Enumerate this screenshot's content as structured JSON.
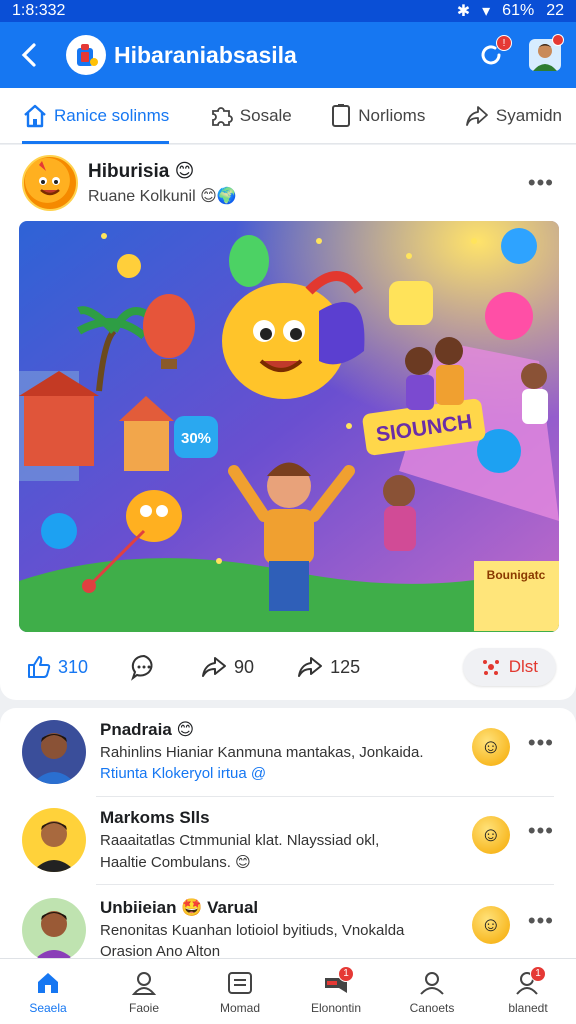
{
  "status_bar": {
    "time": "1:8:332",
    "battery": "61%",
    "clock_right": "22"
  },
  "app": {
    "title": "Hibaraniabsasila"
  },
  "header": {
    "notification_badge": "!",
    "avatar_badge": ""
  },
  "tabs": [
    {
      "label": "Ranice solinms",
      "icon": "home-icon"
    },
    {
      "label": "Sosale",
      "icon": "puzzle-icon"
    },
    {
      "label": "Norlioms",
      "icon": "page-icon"
    },
    {
      "label": "Syamidn",
      "icon": "share-icon"
    }
  ],
  "post": {
    "author": "Hiburisia 😊",
    "subtitle": "Ruane Kolkunil 😊🌍",
    "image": {
      "sign_text": "SIOUNCH",
      "bubble_text": "30%",
      "corner_sign": "Bounigatc"
    },
    "actions": {
      "likes": "310",
      "shares": "90",
      "reposts": "125",
      "main_label": "Dlst"
    }
  },
  "feed": [
    {
      "name": "Pnadraia 😊",
      "line1": "Rahinlins Hianiar Kanmuna mantakas, Jonkaida.",
      "line2": "Rtiunta Klokeryol irtua  @",
      "line2_link": true
    },
    {
      "name": "Markoms Slls",
      "line1": "Raaaitatlas Ctmmunial klat. Nlayssiad okl,",
      "line2": "Haaltie Combulans. 😊",
      "line2_link": false
    },
    {
      "name": "Unbiieian 🤩 Varual",
      "line1": "Renonitas Kuanhan lotioiol byitiuds,  Vnokalda",
      "line2": "Orasion Ano Alton",
      "line2_link": false
    }
  ],
  "bottom_nav": [
    {
      "label": "Seaela",
      "icon": "home-icon",
      "active": true,
      "badge": ""
    },
    {
      "label": "Faoie",
      "icon": "profile-icon",
      "active": false,
      "badge": ""
    },
    {
      "label": "Momad",
      "icon": "message-icon",
      "active": false,
      "badge": ""
    },
    {
      "label": "Elonontin",
      "icon": "notification-icon",
      "active": false,
      "badge": "1"
    },
    {
      "label": "Canoets",
      "icon": "people-icon",
      "active": false,
      "badge": ""
    },
    {
      "label": "blanedt",
      "icon": "contacts-icon",
      "active": false,
      "badge": "1"
    }
  ],
  "colors": {
    "primary": "#1677f2",
    "status_bar": "#0a4fd6",
    "accent_red": "#e2382f"
  }
}
